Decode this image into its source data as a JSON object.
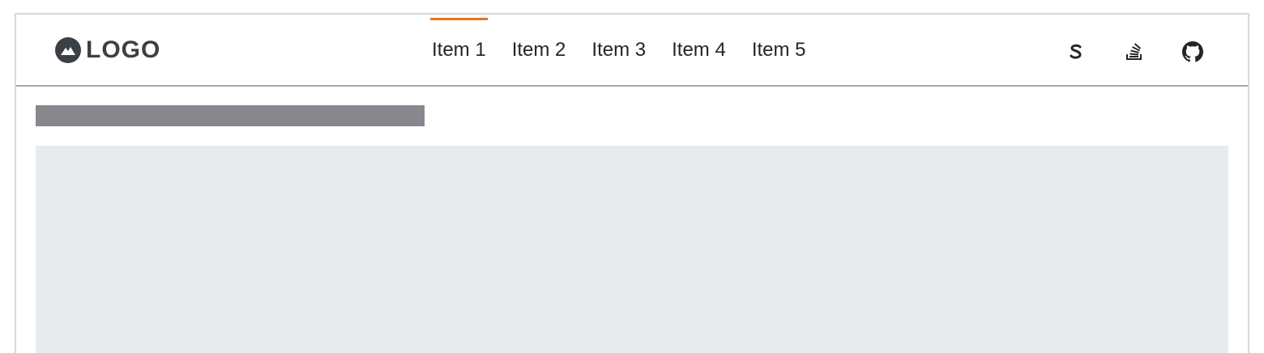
{
  "header": {
    "logo_text": "LOGO",
    "logo_icon": "mountain-icon",
    "nav": [
      {
        "label": "Item 1",
        "active": true
      },
      {
        "label": "Item 2",
        "active": false
      },
      {
        "label": "Item 3",
        "active": false
      },
      {
        "label": "Item 4",
        "active": false
      },
      {
        "label": "Item 5",
        "active": false
      }
    ],
    "actions": [
      {
        "icon": "s-icon"
      },
      {
        "icon": "stack-overflow-icon"
      },
      {
        "icon": "github-icon"
      }
    ]
  },
  "colors": {
    "accent": "#e8741f",
    "text": "#232629",
    "logo": "#3b4045",
    "skeleton_dark": "#86888d",
    "skeleton_light": "#e8ebee"
  }
}
